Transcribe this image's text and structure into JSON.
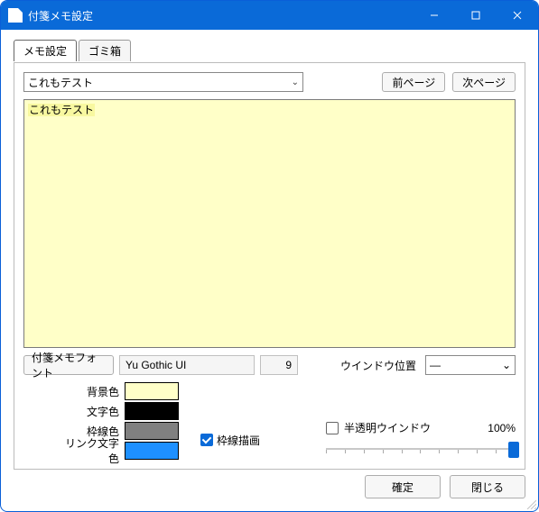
{
  "window": {
    "title": "付箋メモ設定"
  },
  "tabs": {
    "memo": "メモ設定",
    "trash": "ゴミ箱"
  },
  "selector": {
    "value": "これもテスト"
  },
  "paging": {
    "prev": "前ページ",
    "next": "次ページ"
  },
  "preview": {
    "text": "これもテスト"
  },
  "font": {
    "button": "付箋メモフォント",
    "name": "Yu Gothic UI",
    "size": "9"
  },
  "position": {
    "label": "ウインドウ位置",
    "value": "―"
  },
  "colors": {
    "bg_label": "背景色",
    "bg": "#ffffc8",
    "text_label": "文字色",
    "text": "#000000",
    "border_label": "枠線色",
    "border": "#808080",
    "link_label": "リンク文字色",
    "link": "#1e90ff"
  },
  "border_draw": {
    "label": "枠線描画",
    "checked": true
  },
  "opacity": {
    "label": "半透明ウインドウ",
    "checked": false,
    "value": "100%",
    "percent": 100
  },
  "footer": {
    "ok": "確定",
    "close": "閉じる"
  }
}
